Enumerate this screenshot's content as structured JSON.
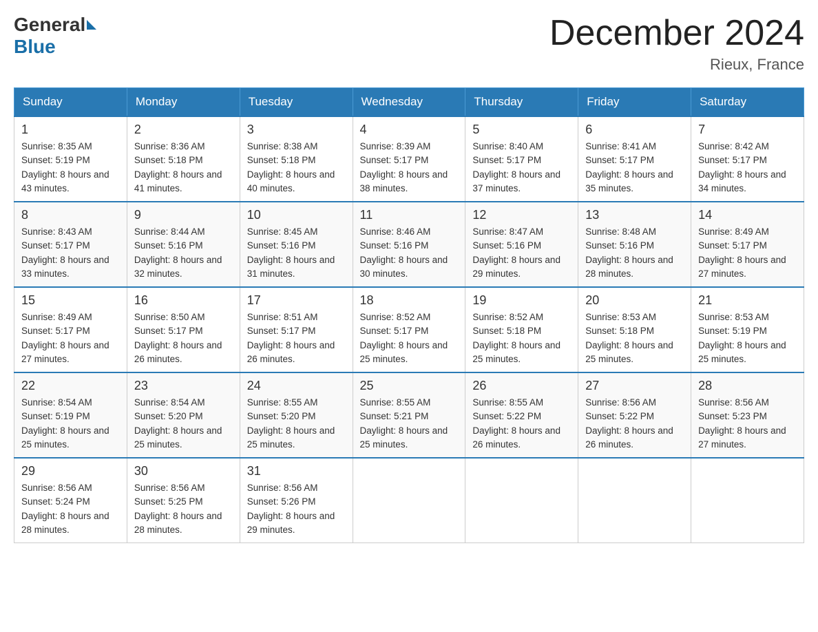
{
  "header": {
    "logo_general": "General",
    "logo_blue": "Blue",
    "title": "December 2024",
    "subtitle": "Rieux, France"
  },
  "weekdays": [
    "Sunday",
    "Monday",
    "Tuesday",
    "Wednesday",
    "Thursday",
    "Friday",
    "Saturday"
  ],
  "weeks": [
    [
      {
        "day": "1",
        "sunrise": "8:35 AM",
        "sunset": "5:19 PM",
        "daylight": "8 hours and 43 minutes."
      },
      {
        "day": "2",
        "sunrise": "8:36 AM",
        "sunset": "5:18 PM",
        "daylight": "8 hours and 41 minutes."
      },
      {
        "day": "3",
        "sunrise": "8:38 AM",
        "sunset": "5:18 PM",
        "daylight": "8 hours and 40 minutes."
      },
      {
        "day": "4",
        "sunrise": "8:39 AM",
        "sunset": "5:17 PM",
        "daylight": "8 hours and 38 minutes."
      },
      {
        "day": "5",
        "sunrise": "8:40 AM",
        "sunset": "5:17 PM",
        "daylight": "8 hours and 37 minutes."
      },
      {
        "day": "6",
        "sunrise": "8:41 AM",
        "sunset": "5:17 PM",
        "daylight": "8 hours and 35 minutes."
      },
      {
        "day": "7",
        "sunrise": "8:42 AM",
        "sunset": "5:17 PM",
        "daylight": "8 hours and 34 minutes."
      }
    ],
    [
      {
        "day": "8",
        "sunrise": "8:43 AM",
        "sunset": "5:17 PM",
        "daylight": "8 hours and 33 minutes."
      },
      {
        "day": "9",
        "sunrise": "8:44 AM",
        "sunset": "5:16 PM",
        "daylight": "8 hours and 32 minutes."
      },
      {
        "day": "10",
        "sunrise": "8:45 AM",
        "sunset": "5:16 PM",
        "daylight": "8 hours and 31 minutes."
      },
      {
        "day": "11",
        "sunrise": "8:46 AM",
        "sunset": "5:16 PM",
        "daylight": "8 hours and 30 minutes."
      },
      {
        "day": "12",
        "sunrise": "8:47 AM",
        "sunset": "5:16 PM",
        "daylight": "8 hours and 29 minutes."
      },
      {
        "day": "13",
        "sunrise": "8:48 AM",
        "sunset": "5:16 PM",
        "daylight": "8 hours and 28 minutes."
      },
      {
        "day": "14",
        "sunrise": "8:49 AM",
        "sunset": "5:17 PM",
        "daylight": "8 hours and 27 minutes."
      }
    ],
    [
      {
        "day": "15",
        "sunrise": "8:49 AM",
        "sunset": "5:17 PM",
        "daylight": "8 hours and 27 minutes."
      },
      {
        "day": "16",
        "sunrise": "8:50 AM",
        "sunset": "5:17 PM",
        "daylight": "8 hours and 26 minutes."
      },
      {
        "day": "17",
        "sunrise": "8:51 AM",
        "sunset": "5:17 PM",
        "daylight": "8 hours and 26 minutes."
      },
      {
        "day": "18",
        "sunrise": "8:52 AM",
        "sunset": "5:17 PM",
        "daylight": "8 hours and 25 minutes."
      },
      {
        "day": "19",
        "sunrise": "8:52 AM",
        "sunset": "5:18 PM",
        "daylight": "8 hours and 25 minutes."
      },
      {
        "day": "20",
        "sunrise": "8:53 AM",
        "sunset": "5:18 PM",
        "daylight": "8 hours and 25 minutes."
      },
      {
        "day": "21",
        "sunrise": "8:53 AM",
        "sunset": "5:19 PM",
        "daylight": "8 hours and 25 minutes."
      }
    ],
    [
      {
        "day": "22",
        "sunrise": "8:54 AM",
        "sunset": "5:19 PM",
        "daylight": "8 hours and 25 minutes."
      },
      {
        "day": "23",
        "sunrise": "8:54 AM",
        "sunset": "5:20 PM",
        "daylight": "8 hours and 25 minutes."
      },
      {
        "day": "24",
        "sunrise": "8:55 AM",
        "sunset": "5:20 PM",
        "daylight": "8 hours and 25 minutes."
      },
      {
        "day": "25",
        "sunrise": "8:55 AM",
        "sunset": "5:21 PM",
        "daylight": "8 hours and 25 minutes."
      },
      {
        "day": "26",
        "sunrise": "8:55 AM",
        "sunset": "5:22 PM",
        "daylight": "8 hours and 26 minutes."
      },
      {
        "day": "27",
        "sunrise": "8:56 AM",
        "sunset": "5:22 PM",
        "daylight": "8 hours and 26 minutes."
      },
      {
        "day": "28",
        "sunrise": "8:56 AM",
        "sunset": "5:23 PM",
        "daylight": "8 hours and 27 minutes."
      }
    ],
    [
      {
        "day": "29",
        "sunrise": "8:56 AM",
        "sunset": "5:24 PM",
        "daylight": "8 hours and 28 minutes."
      },
      {
        "day": "30",
        "sunrise": "8:56 AM",
        "sunset": "5:25 PM",
        "daylight": "8 hours and 28 minutes."
      },
      {
        "day": "31",
        "sunrise": "8:56 AM",
        "sunset": "5:26 PM",
        "daylight": "8 hours and 29 minutes."
      },
      null,
      null,
      null,
      null
    ]
  ]
}
